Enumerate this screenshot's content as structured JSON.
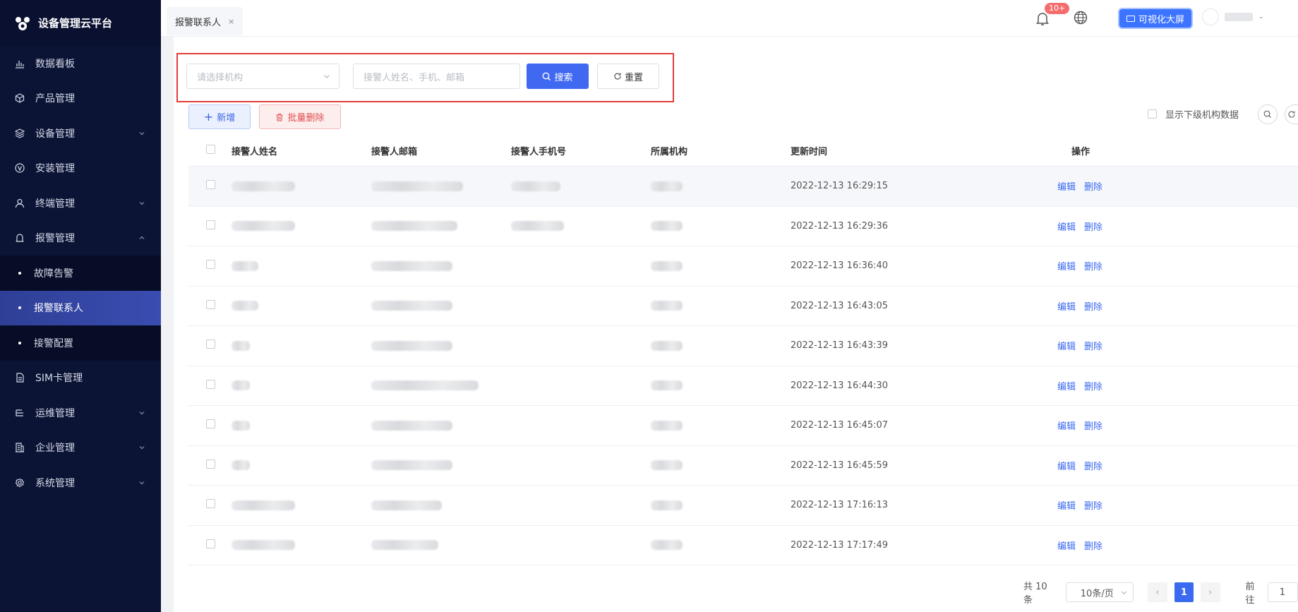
{
  "app": {
    "title": "设备管理云平台"
  },
  "sidebar": {
    "items": [
      {
        "label": "数据看板",
        "icon": "bar-chart-icon"
      },
      {
        "label": "产品管理",
        "icon": "cube-icon"
      },
      {
        "label": "设备管理",
        "icon": "layers-icon",
        "expandable": true
      },
      {
        "label": "安装管理",
        "icon": "v-circle-icon"
      },
      {
        "label": "终端管理",
        "icon": "user-icon",
        "expandable": true
      },
      {
        "label": "报警管理",
        "icon": "alarm-icon",
        "expanded": true
      }
    ],
    "sub_items": [
      {
        "label": "故障告警"
      },
      {
        "label": "报警联系人",
        "active": true
      },
      {
        "label": "接警配置"
      }
    ],
    "items_after": [
      {
        "label": "SIM卡管理",
        "icon": "sim-card-icon"
      },
      {
        "label": "运维管理",
        "icon": "tool-icon",
        "expandable": true
      },
      {
        "label": "企业管理",
        "icon": "building-icon",
        "expandable": true
      },
      {
        "label": "系统管理",
        "icon": "gear-icon",
        "expandable": true
      }
    ]
  },
  "header": {
    "tab_label": "报警联系人",
    "tab_close": "×",
    "notification_badge": "10+",
    "bigscreen_label": "可视化大屏",
    "user_caret": "⌄"
  },
  "search": {
    "org_placeholder": "请选择机构",
    "keyword_placeholder": "接警人姓名、手机、邮箱",
    "search_label": "搜索",
    "reset_label": "重置"
  },
  "toolbar": {
    "add_label": "新增",
    "batch_delete_label": "批量删除",
    "show_sub_org_label": "显示下级机构数据"
  },
  "table": {
    "columns": [
      "接警人姓名",
      "接警人邮箱",
      "接警人手机号",
      "所属机构",
      "更新时间",
      "操作"
    ],
    "edit_label": "编辑",
    "delete_label": "删除",
    "rows": [
      {
        "updated": "2022-12-13 16:29:15"
      },
      {
        "updated": "2022-12-13 16:29:36"
      },
      {
        "updated": "2022-12-13 16:36:40"
      },
      {
        "updated": "2022-12-13 16:43:05"
      },
      {
        "updated": "2022-12-13 16:43:39"
      },
      {
        "updated": "2022-12-13 16:44:30"
      },
      {
        "updated": "2022-12-13 16:45:07"
      },
      {
        "updated": "2022-12-13 16:45:59"
      },
      {
        "updated": "2022-12-13 17:16:13"
      },
      {
        "updated": "2022-12-13 17:17:49"
      }
    ]
  },
  "pagination": {
    "total_label": "共 10 条",
    "page_size_label": "10条/页",
    "prev_label": "‹",
    "current_page": "1",
    "next_label": "›",
    "goto_label": "前往",
    "goto_value": "1"
  },
  "colors": {
    "sidebar_bg": "#0c1436",
    "active_item": "#3a4db0",
    "primary": "#4069f2",
    "danger": "#e04d4d",
    "highlight_border": "#e23b3b"
  }
}
